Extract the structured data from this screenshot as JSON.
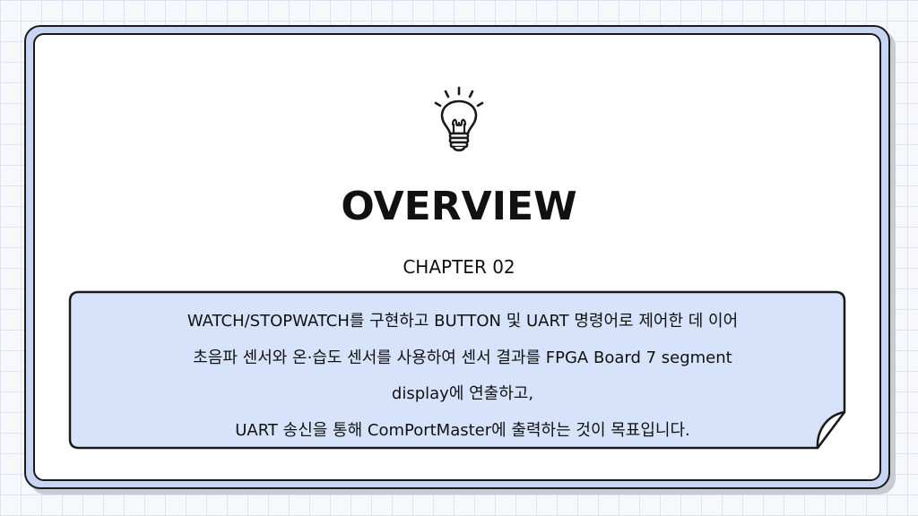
{
  "slide": {
    "title": "OVERVIEW",
    "subtitle": "CHAPTER 02",
    "description_lines": [
      "WATCH/STOPWATCH를 구현하고 BUTTON 및 UART 명령어로 제어한 데 이어",
      "초음파 센서와 온·습도 센서를 사용하여 센서 결과를 FPGA Board 7 segment",
      "display에 연출하고,",
      "UART 송신을 통해 ComPortMaster에 출력하는 것이 목표입니다."
    ]
  },
  "icons": {
    "lightbulb": "lightbulb-icon"
  },
  "colors": {
    "frame_fill": "#c7d5f2",
    "description_fill": "#d6e3fb",
    "outline": "#1a1a1a",
    "grid_line": "#dde3f2",
    "background": "#f7f8fc"
  }
}
